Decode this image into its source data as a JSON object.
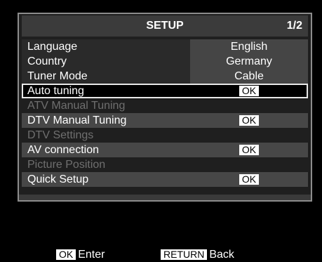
{
  "header": {
    "title": "SETUP",
    "page": "1/2"
  },
  "rows": [
    {
      "label": "Language",
      "value": "English"
    },
    {
      "label": "Country",
      "value": "Germany"
    },
    {
      "label": "Tuner Mode",
      "value": "Cable"
    },
    {
      "label": "Auto tuning",
      "value": "OK"
    },
    {
      "label": "ATV Manual Tuning",
      "value": ""
    },
    {
      "label": "DTV Manual Tuning",
      "value": "OK"
    },
    {
      "label": "DTV Settings",
      "value": ""
    },
    {
      "label": "AV connection",
      "value": "OK"
    },
    {
      "label": "Picture Position",
      "value": ""
    },
    {
      "label": "Quick Setup",
      "value": "OK"
    }
  ],
  "footer": {
    "enter_key": "OK",
    "enter_label": "Enter",
    "back_key": "RETURN",
    "back_label": "Back"
  }
}
